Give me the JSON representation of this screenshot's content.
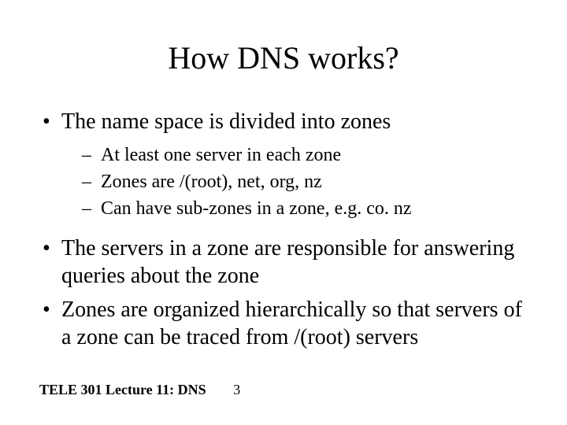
{
  "title": "How DNS works?",
  "bullets": [
    {
      "text": "The name space is divided into zones",
      "sub": [
        "At least one server in each zone",
        "Zones are /(root), net, org, nz",
        "Can have sub-zones in a zone, e.g. co. nz"
      ]
    },
    {
      "text": "The servers in a zone are responsible for answering queries about the zone",
      "sub": []
    },
    {
      "text": "Zones are organized hierarchically so that servers of a zone can be traced from /(root) servers",
      "sub": []
    }
  ],
  "footer": {
    "label": "TELE 301 Lecture 11: DNS",
    "page": "3"
  }
}
